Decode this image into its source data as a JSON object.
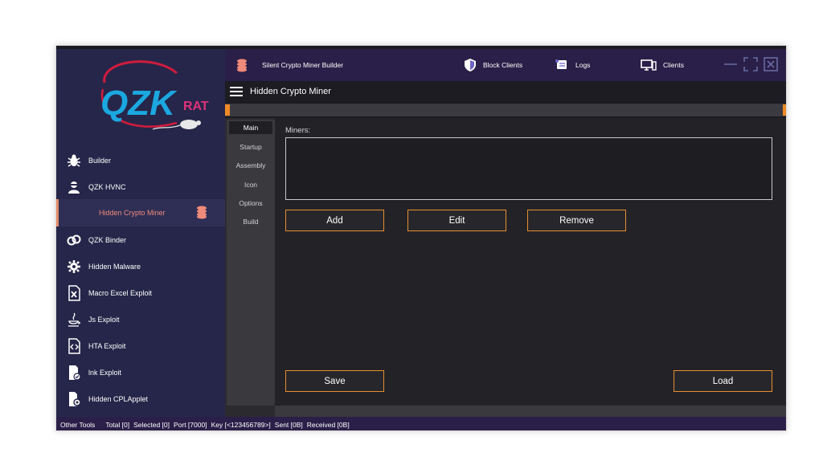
{
  "logo": {
    "main": "QZK",
    "sub": "RAT"
  },
  "sidebar": {
    "items": [
      {
        "label": "Builder",
        "icon": "bug-icon"
      },
      {
        "label": "QZK HVNC",
        "icon": "hacker-icon"
      },
      {
        "label": "Hidden Crypto Miner",
        "icon": "coins-icon",
        "active": true
      },
      {
        "label": "QZK Binder",
        "icon": "link-icon"
      },
      {
        "label": "Hidden Malware",
        "icon": "gear-icon"
      },
      {
        "label": "Macro Excel Exploit",
        "icon": "excel-file-icon"
      },
      {
        "label": "Js Exploit",
        "icon": "java-icon"
      },
      {
        "label": "HTA Exploit",
        "icon": "code-file-icon"
      },
      {
        "label": "lnk Exploit",
        "icon": "shortcut-file-icon"
      },
      {
        "label": "Hidden CPLApplet",
        "icon": "settings-file-icon"
      }
    ]
  },
  "topbar": {
    "app_title": "Silent Crypto Miner Builder",
    "block_clients": "Block Clients",
    "logs": "Logs",
    "clients": "Clients"
  },
  "subbar": {
    "title": "Hidden Crypto Miner"
  },
  "tabs": [
    "Main",
    "Startup",
    "Assembly",
    "Icon",
    "Options",
    "Build"
  ],
  "main": {
    "miners_label": "Miners:",
    "add": "Add",
    "edit": "Edit",
    "remove": "Remove",
    "save": "Save",
    "load": "Load"
  },
  "status": {
    "other_tools": "Other Tools",
    "total": "Total [0]",
    "selected": "Selected [0]",
    "port": "Port [7000]",
    "key": "Key [<123456789>]",
    "sent": "Sent [0B]",
    "received": "Received [0B]"
  },
  "colors": {
    "accent": "#e88d2d",
    "sidebar": "#26264a",
    "topbar": "#2a1f48",
    "active_text": "#f08a7a"
  }
}
